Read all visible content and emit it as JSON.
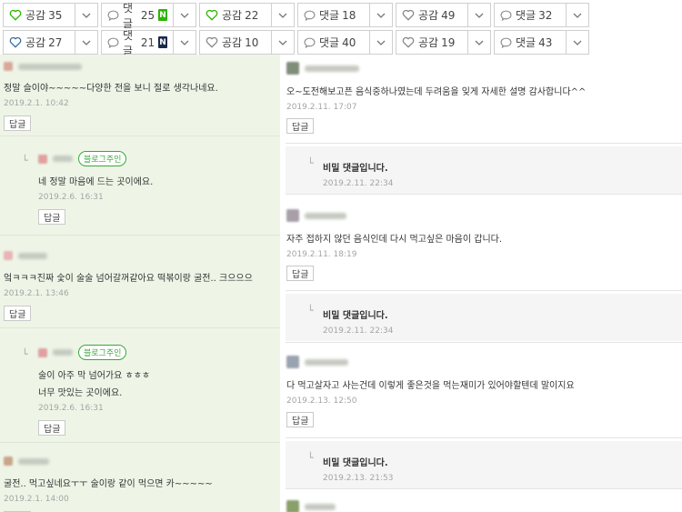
{
  "reactions_row1": [
    {
      "label": "공감",
      "count": "35",
      "icon": "heart-outline-icon",
      "color": "#2db400",
      "badge": ""
    },
    {
      "label": "댓글",
      "count": "25",
      "icon": "speech-bubble-icon",
      "color": "#888888",
      "badge": "N",
      "badge_color": "#2db400"
    },
    {
      "label": "공감",
      "count": "22",
      "icon": "heart-outline-icon",
      "color": "#2db400",
      "badge": ""
    },
    {
      "label": "댓글",
      "count": "18",
      "icon": "speech-bubble-icon",
      "color": "#888888",
      "badge": ""
    },
    {
      "label": "공감",
      "count": "49",
      "icon": "heart-outline-icon",
      "color": "#888888",
      "badge": ""
    },
    {
      "label": "댓글",
      "count": "32",
      "icon": "speech-bubble-icon",
      "color": "#888888",
      "badge": ""
    }
  ],
  "reactions_row2": [
    {
      "label": "공감",
      "count": "27",
      "icon": "heart-outline-icon",
      "color": "#3a6ea5",
      "badge": ""
    },
    {
      "label": "댓글",
      "count": "21",
      "icon": "speech-bubble-icon",
      "color": "#888888",
      "badge": "N",
      "badge_color": "#1b2a4a"
    },
    {
      "label": "공감",
      "count": "10",
      "icon": "heart-outline-icon",
      "color": "#888888",
      "badge": ""
    },
    {
      "label": "댓글",
      "count": "40",
      "icon": "speech-bubble-icon",
      "color": "#888888",
      "badge": ""
    },
    {
      "label": "공감",
      "count": "19",
      "icon": "heart-outline-icon",
      "color": "#888888",
      "badge": ""
    },
    {
      "label": "댓글",
      "count": "43",
      "icon": "speech-bubble-icon",
      "color": "#888888",
      "badge": ""
    }
  ],
  "left_comments": {
    "c1": {
      "text": "정말 슬이야~~~~~다양한 전을 보니 절로 생각나네요.",
      "date": "2019.2.1. 10:42",
      "reply": "답글"
    },
    "c1_reply": {
      "badge": "블로그주인",
      "text": "네 정말 마음에 드는 곳이에요.",
      "date": "2019.2.6. 16:31",
      "reply": "답글"
    },
    "c2": {
      "text": "엌ㅋㅋㅋ진짜 숯이 술술 넘어갈꺼같아요 떡볶이랑 굴전.. 크으으으",
      "date": "2019.2.1. 13:46",
      "reply": "답글"
    },
    "c2_reply": {
      "badge": "블로그주인",
      "text1": "술이 아주 막 넘어가요 ㅎㅎㅎ",
      "text2": "너무 맛있는 곳이에요.",
      "date": "2019.2.6. 16:31",
      "reply": "답글"
    },
    "c3": {
      "text": "굴전.. 먹고싶네요ㅜㅜ 술이랑 같이 먹으면 카~~~~~",
      "date": "2019.2.1. 14:00",
      "reply": "답글"
    }
  },
  "right_comments": {
    "c1": {
      "text": "오~도전해보고픈 음식중하나였는데 두려움을 잊게 자세한 설명 감사합니다^^",
      "date": "2019.2.11. 17:07",
      "reply": "답글"
    },
    "s1": {
      "title": "비밀 댓글입니다.",
      "date": "2019.2.11. 22:34"
    },
    "c2": {
      "text": "자주 접하지 않던 음식인데 다시 먹고싶은 마음이 갑니다.",
      "date": "2019.2.11. 18:19",
      "reply": "답글"
    },
    "s2": {
      "title": "비밀 댓글입니다.",
      "date": "2019.2.11. 22:34"
    },
    "c3": {
      "text": "다 먹고살자고 사는건데 이렇게 좋은것을 먹는재미가 있어야할텐데 말이지요",
      "date": "2019.2.13. 12:50",
      "reply": "답글"
    },
    "s3": {
      "title": "비밀 댓글입니다.",
      "date": "2019.2.13. 21:53"
    }
  }
}
